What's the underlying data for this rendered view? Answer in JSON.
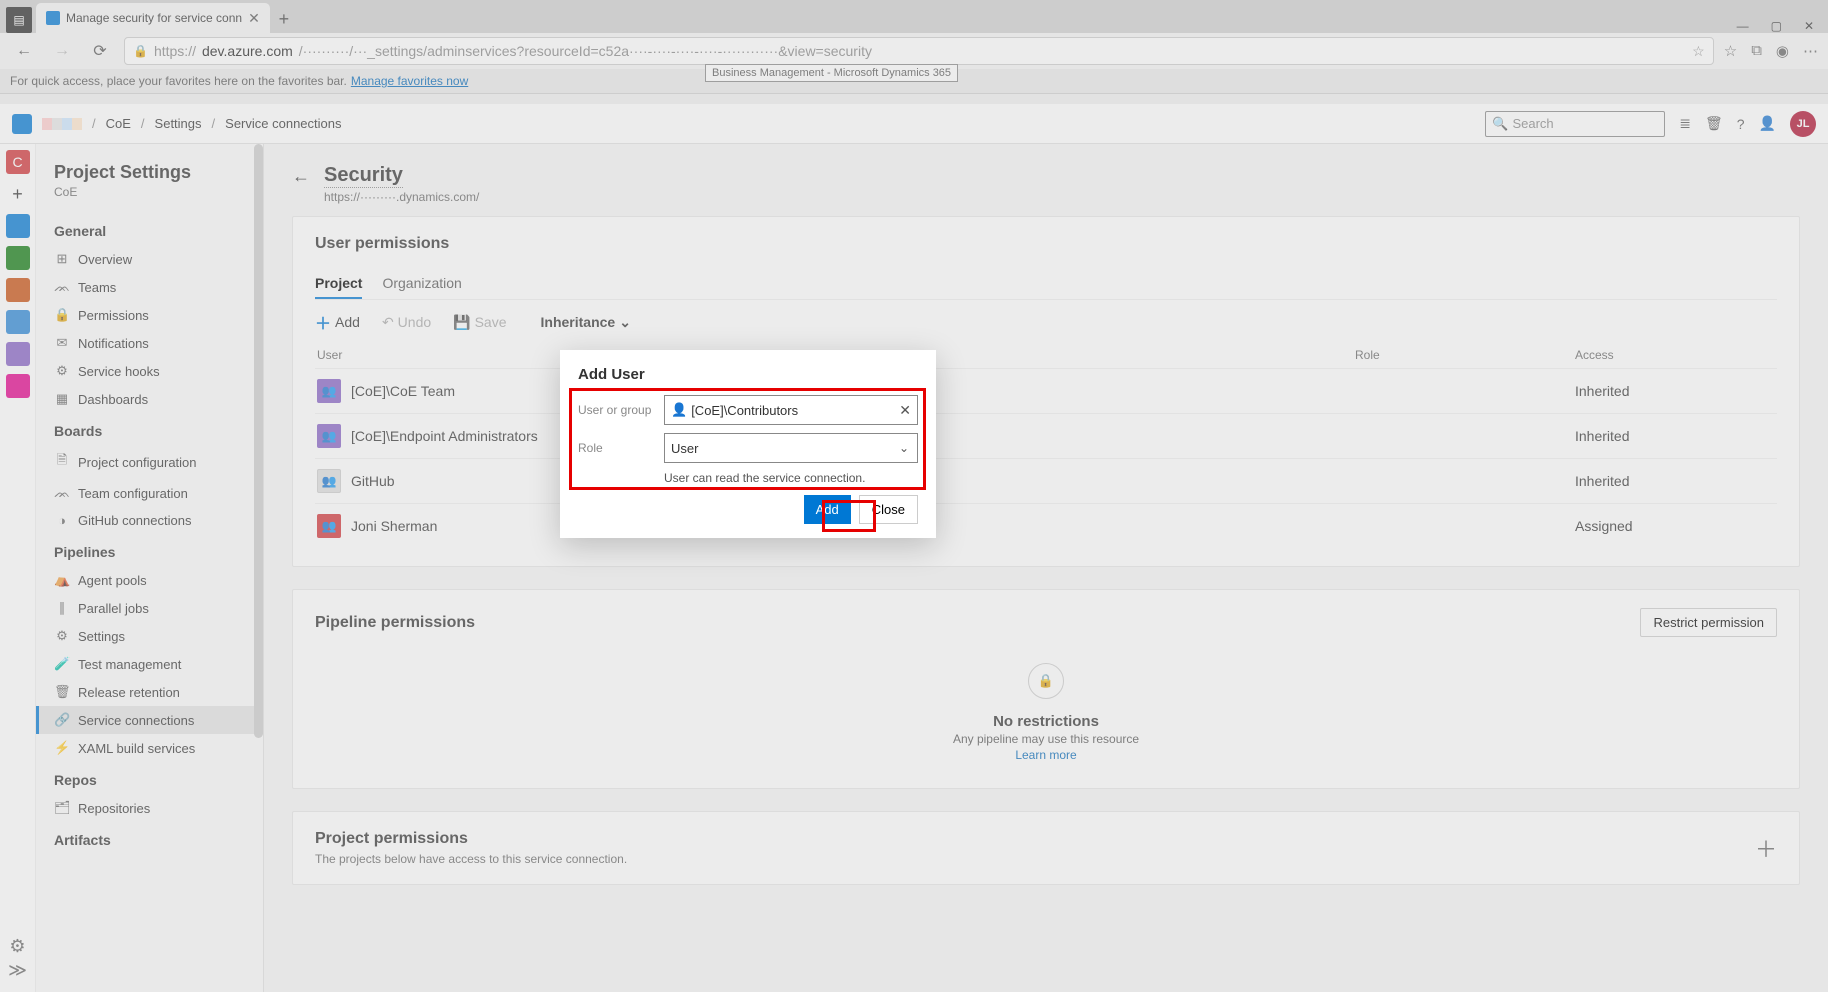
{
  "browser": {
    "tab_title": "Manage security for service conn",
    "tooltip": "Business Management - Microsoft Dynamics 365",
    "url_prefix": "https://",
    "url_host": "dev.azure.com",
    "url_path": "/··········/···_settings/adminservices?resourceId=c52a····-····-····-····-············&view=security",
    "fav_text": "For quick access, place your favorites here on the favorites bar.",
    "fav_link": "Manage favorites now"
  },
  "header": {
    "crumbs": [
      "CoE",
      "Settings",
      "Service connections"
    ],
    "search_placeholder": "Search",
    "avatar": "JL"
  },
  "sidepanel": {
    "title": "Project Settings",
    "subtitle": "CoE",
    "sections": [
      {
        "heading": "General",
        "items": [
          {
            "icon": "⊞",
            "label": "Overview"
          },
          {
            "icon": "ᨏ",
            "label": "Teams"
          },
          {
            "icon": "🔒",
            "label": "Permissions"
          },
          {
            "icon": "✉",
            "label": "Notifications"
          },
          {
            "icon": "⚙",
            "label": "Service hooks"
          },
          {
            "icon": "▦",
            "label": "Dashboards"
          }
        ]
      },
      {
        "heading": "Boards",
        "items": [
          {
            "icon": "🗎",
            "label": "Project configuration"
          },
          {
            "icon": "ᨏ",
            "label": "Team configuration"
          },
          {
            "icon": "◑",
            "label": "GitHub connections"
          }
        ]
      },
      {
        "heading": "Pipelines",
        "items": [
          {
            "icon": "⛺",
            "label": "Agent pools"
          },
          {
            "icon": "∥",
            "label": "Parallel jobs"
          },
          {
            "icon": "⚙",
            "label": "Settings"
          },
          {
            "icon": "🧪",
            "label": "Test management"
          },
          {
            "icon": "🗑",
            "label": "Release retention"
          },
          {
            "icon": "🔗",
            "label": "Service connections",
            "active": true
          },
          {
            "icon": "⚡",
            "label": "XAML build services"
          }
        ]
      },
      {
        "heading": "Repos",
        "items": [
          {
            "icon": "🗂",
            "label": "Repositories"
          }
        ]
      },
      {
        "heading": "Artifacts",
        "items": []
      }
    ]
  },
  "page": {
    "title": "Security",
    "subtitle": "https://·········.dynamics.com/",
    "user_permissions": {
      "heading": "User permissions",
      "tabs": [
        "Project",
        "Organization"
      ],
      "toolbar": {
        "add": "Add",
        "undo": "Undo",
        "save": "Save",
        "inheritance": "Inheritance"
      },
      "cols": [
        "User",
        "Role",
        "Access"
      ],
      "rows": [
        {
          "avatar": "purple",
          "name": "[CoE]\\CoE Team",
          "access": "Inherited"
        },
        {
          "avatar": "purple",
          "name": "[CoE]\\Endpoint Administrators",
          "access": "Inherited"
        },
        {
          "avatar": "grey",
          "name": "GitHub",
          "access": "Inherited"
        },
        {
          "avatar": "red",
          "name": "Joni Sherman",
          "access": "Assigned"
        }
      ]
    },
    "pipeline_permissions": {
      "heading": "Pipeline permissions",
      "restrict_btn": "Restrict permission",
      "empty_title": "No restrictions",
      "empty_sub": "Any pipeline may use this resource",
      "learn_more": "Learn more"
    },
    "project_permissions": {
      "heading": "Project permissions",
      "sub": "The projects below have access to this service connection."
    }
  },
  "modal": {
    "title": "Add User",
    "user_label": "User or group",
    "user_value": "[CoE]\\Contributors",
    "role_label": "Role",
    "role_value": "User",
    "hint": "User can read the service connection.",
    "add": "Add",
    "close": "Close"
  }
}
